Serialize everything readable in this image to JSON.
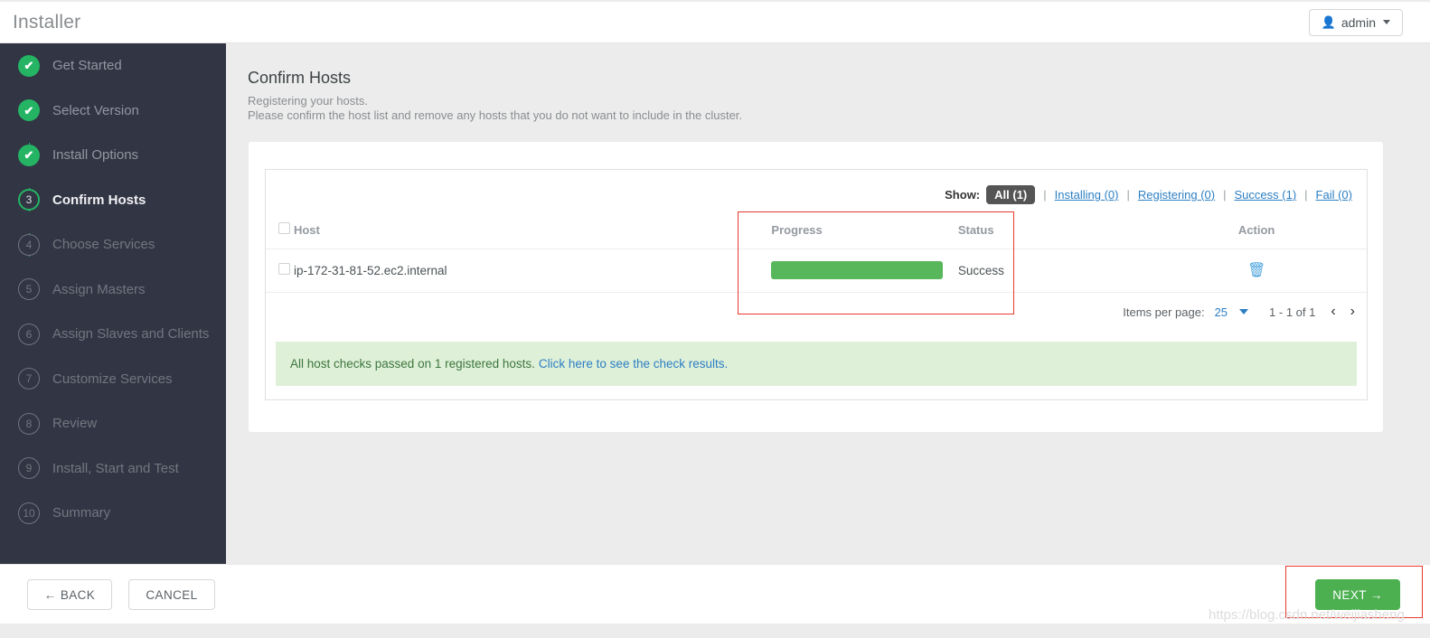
{
  "topbar": {
    "title": "Installer",
    "user_icon": "user-icon",
    "user_label": "admin"
  },
  "sidebar": {
    "steps": [
      {
        "marker": "✔",
        "label": "Get Started",
        "state": "done"
      },
      {
        "marker": "✔",
        "label": "Select Version",
        "state": "done"
      },
      {
        "marker": "✔",
        "label": "Install Options",
        "state": "done"
      },
      {
        "marker": "3",
        "label": "Confirm Hosts",
        "state": "current"
      },
      {
        "marker": "4",
        "label": "Choose Services",
        "state": "todo"
      },
      {
        "marker": "5",
        "label": "Assign Masters",
        "state": "todo"
      },
      {
        "marker": "6",
        "label": "Assign Slaves and Clients",
        "state": "todo"
      },
      {
        "marker": "7",
        "label": "Customize Services",
        "state": "todo"
      },
      {
        "marker": "8",
        "label": "Review",
        "state": "todo"
      },
      {
        "marker": "9",
        "label": "Install, Start and Test",
        "state": "todo"
      },
      {
        "marker": "10",
        "label": "Summary",
        "state": "todo"
      }
    ]
  },
  "main": {
    "title": "Confirm Hosts",
    "description_line1": "Registering your hosts.",
    "description_line2": "Please confirm the host list and remove any hosts that you do not want to include in the cluster.",
    "filter": {
      "show_label": "Show:",
      "active": "All (1)",
      "separator": "|",
      "links": [
        "Installing (0)",
        "Registering (0)",
        "Success (1)",
        "Fail (0)"
      ]
    },
    "table": {
      "headers": [
        "Host",
        "Progress",
        "Status",
        "Action"
      ],
      "rows": [
        {
          "host": "ip-172-31-81-52.ec2.internal",
          "progress_percent": 100,
          "status": "Success",
          "action_icon": "trash-icon",
          "action_glyph": "🗑"
        }
      ]
    },
    "pager": {
      "items_per_page_label": "Items per page:",
      "items_per_page_value": "25",
      "range": "1 - 1 of 1",
      "prev_glyph": "‹",
      "next_glyph": "›"
    },
    "alert": {
      "text": "All host checks passed on 1 registered hosts.",
      "link": "Click here to see the check results."
    }
  },
  "footer": {
    "back_label": "← BACK",
    "cancel_label": "CANCEL",
    "next_label": "NEXT →"
  },
  "watermark": "https://blog.csdn.net/weijiasheng",
  "colors": {
    "accent_green": "#24b463",
    "progress_green": "#57b75a",
    "next_green": "#4cb050",
    "link_blue": "#2c7fc4",
    "sidebar_bg": "#323544",
    "annotation_red": "#e8392f"
  }
}
